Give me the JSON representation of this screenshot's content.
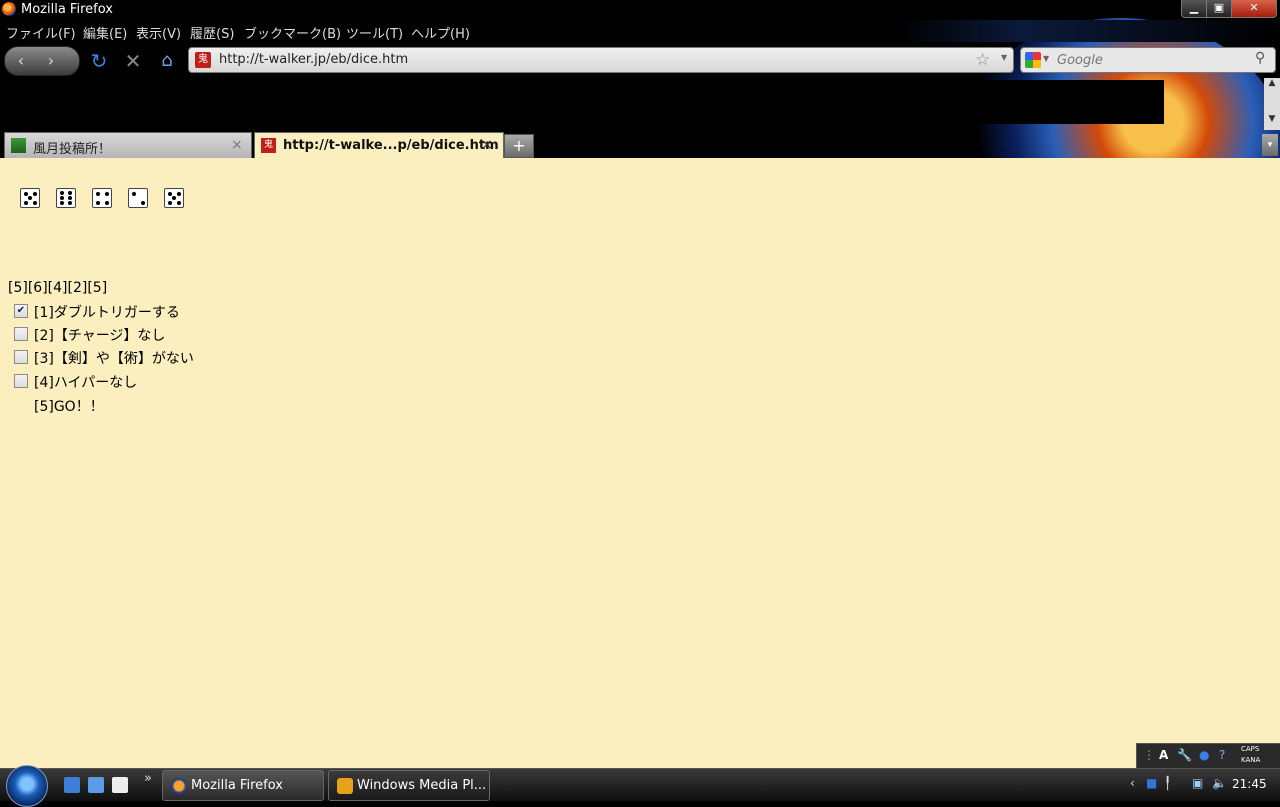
{
  "window": {
    "title": "Mozilla Firefox",
    "minimize": "▁",
    "maximize": "▣",
    "close": "✕"
  },
  "menu": [
    "ファイル(F)",
    "編集(E)",
    "表示(V)",
    "履歴(S)",
    "ブックマーク(B)",
    "ツール(T)",
    "ヘルプ(H)"
  ],
  "navigation": {
    "back": "‹",
    "forward": "›",
    "reload": "↻",
    "stop": "✕",
    "home": "⌂",
    "url": "http://t-walker.jp/eb/dice.htm",
    "bookmark_star": "☆",
    "search_placeholder": "Google",
    "search_go": "⚲"
  },
  "tabs": [
    {
      "label": "風月投稿所！",
      "close": "×"
    },
    {
      "label": "http://t-walke...p/eb/dice.htm",
      "close": "×"
    }
  ],
  "new_tab": "+",
  "tab_list": "▾",
  "dice": [
    5,
    6,
    4,
    2,
    5
  ],
  "result_text": "[5][6][4][2][5]",
  "options": [
    {
      "label": "[1]ダブルトリガーする",
      "checked": true
    },
    {
      "label": "[2]【チャージ】なし",
      "checked": false
    },
    {
      "label": "[3]【剣】や【術】がない",
      "checked": false
    },
    {
      "label": "[4]ハイパーなし",
      "checked": false
    },
    {
      "label": "[5]GO！！",
      "checkbox": false
    }
  ],
  "language_bar": {
    "ime": "A",
    "tools": "🔧",
    "help": "?",
    "caps": "CAPS",
    "kana": "KANA"
  },
  "taskbar": {
    "tasks": [
      "Mozilla Firefox",
      "Windows Media Pl..."
    ],
    "more": "»",
    "tray_arrow": "‹",
    "clock": "21:45"
  },
  "colors": {
    "page_background": "#fbeebf",
    "chrome_background": "#000000"
  }
}
